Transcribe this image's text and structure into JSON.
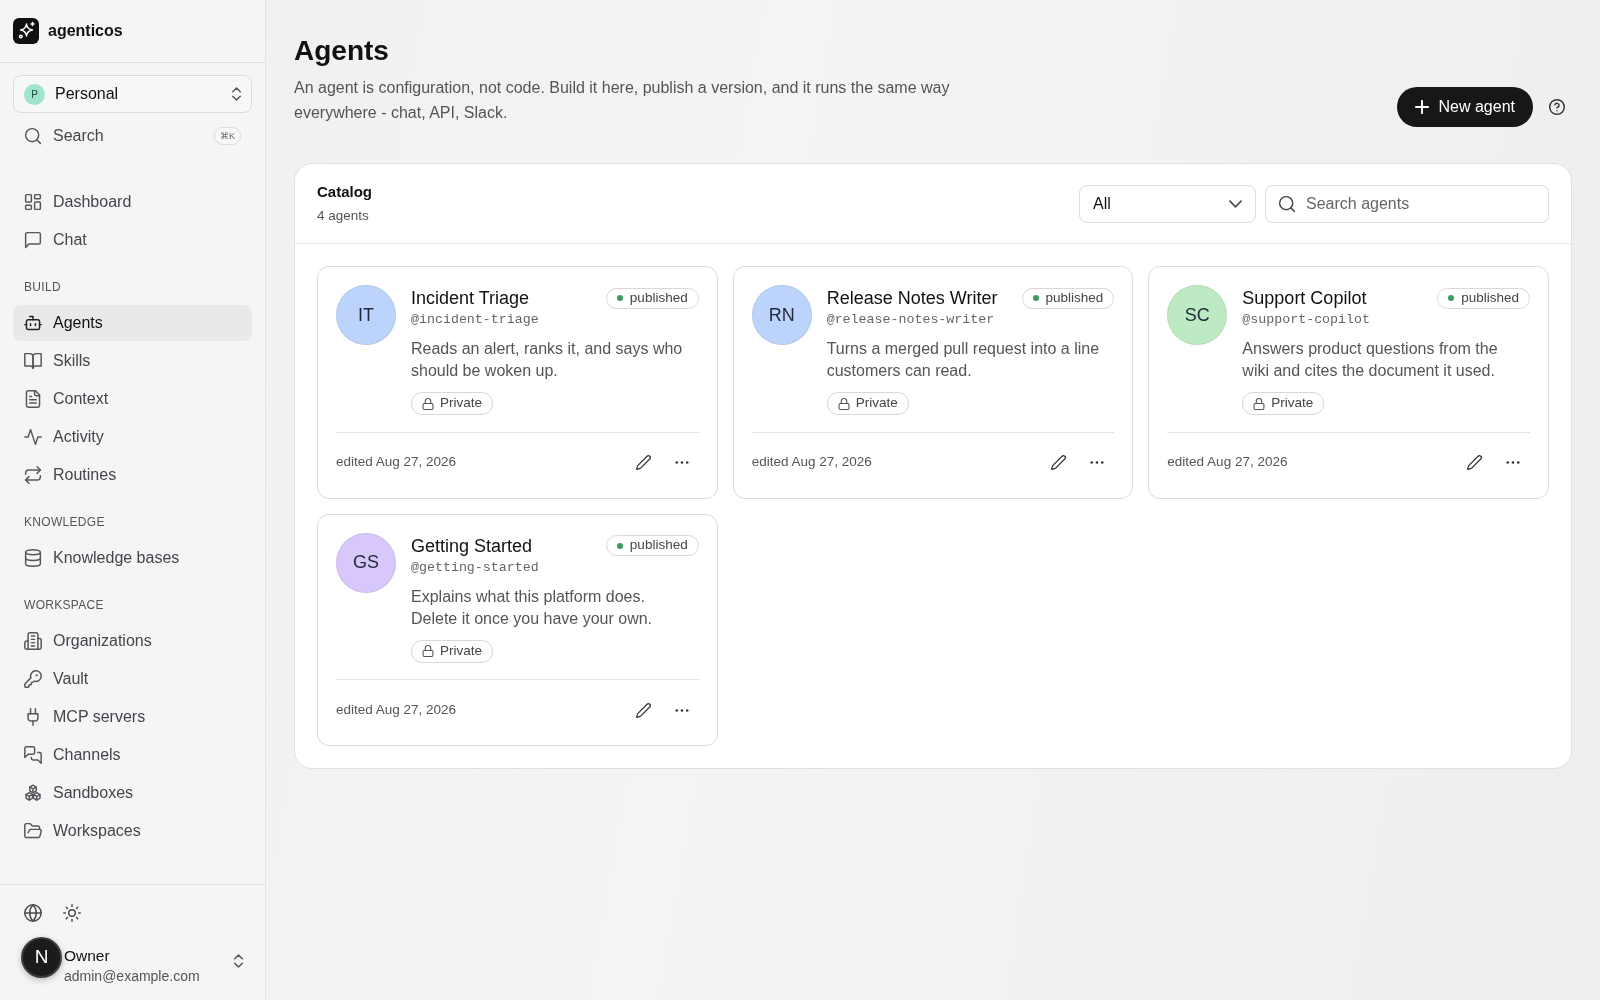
{
  "brand": {
    "name": "agenticos"
  },
  "workspace_switcher": {
    "initial": "P",
    "label": "Personal"
  },
  "sidebar_search": {
    "label": "Search",
    "shortcut": "⌘K"
  },
  "nav_sections": [
    {
      "items": [
        {
          "label": "Dashboard",
          "selected": false
        },
        {
          "label": "Chat",
          "selected": false
        }
      ]
    },
    {
      "heading": "BUILD",
      "items": [
        {
          "label": "Agents",
          "selected": true
        },
        {
          "label": "Skills",
          "selected": false
        },
        {
          "label": "Context",
          "selected": false
        },
        {
          "label": "Activity",
          "selected": false
        },
        {
          "label": "Routines",
          "selected": false
        }
      ]
    },
    {
      "heading": "KNOWLEDGE",
      "items": [
        {
          "label": "Knowledge bases",
          "selected": false
        }
      ]
    },
    {
      "heading": "WORKSPACE",
      "items": [
        {
          "label": "Organizations",
          "selected": false
        },
        {
          "label": "Vault",
          "selected": false
        },
        {
          "label": "MCP servers",
          "selected": false
        },
        {
          "label": "Channels",
          "selected": false
        },
        {
          "label": "Sandboxes",
          "selected": false
        },
        {
          "label": "Workspaces",
          "selected": false
        }
      ]
    }
  ],
  "user": {
    "name": "Owner",
    "email": "admin@example.com"
  },
  "dev_badge": {
    "letter": "N"
  },
  "page": {
    "title": "Agents",
    "description": "An agent is configuration, not code. Build it here, publish a version, and it runs the same way everywhere - chat, API, Slack.",
    "new_button": {
      "label": "New agent"
    }
  },
  "catalog": {
    "title": "Catalog",
    "count": "4 agents",
    "filter": {
      "value": "All"
    },
    "search": {
      "placeholder": "Search agents"
    },
    "agents": [
      {
        "initials": "IT",
        "color": "#bcd3fb",
        "name": "Incident Triage",
        "handle": "@incident-triage",
        "status": "published",
        "description": "Reads an alert, ranks it, and says who should be woken up.",
        "visibility": "Private",
        "edited": "edited Aug 27, 2026"
      },
      {
        "initials": "RN",
        "color": "#bcd3fb",
        "name": "Release Notes Writer",
        "handle": "@release-notes-writer",
        "status": "published",
        "description": "Turns a merged pull request into a line customers can read.",
        "visibility": "Private",
        "edited": "edited Aug 27, 2026"
      },
      {
        "initials": "SC",
        "color": "#bde9c3",
        "name": "Support Copilot",
        "handle": "@support-copilot",
        "status": "published",
        "description": "Answers product questions from the wiki and cites the document it used.",
        "visibility": "Private",
        "edited": "edited Aug 27, 2026"
      },
      {
        "initials": "GS",
        "color": "#d7c7fb",
        "name": "Getting Started",
        "handle": "@getting-started",
        "status": "published",
        "description": "Explains what this platform does. Delete it once you have your own.",
        "visibility": "Private",
        "edited": "edited Aug 27, 2026"
      }
    ]
  }
}
